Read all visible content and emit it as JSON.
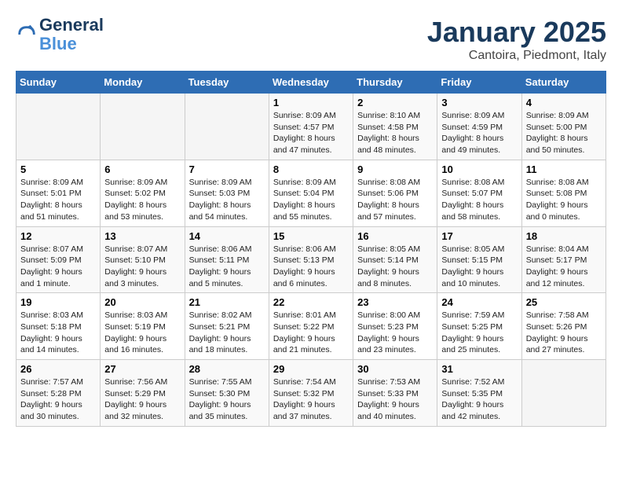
{
  "header": {
    "logo_line1": "General",
    "logo_line2": "Blue",
    "month": "January 2025",
    "location": "Cantoira, Piedmont, Italy"
  },
  "weekdays": [
    "Sunday",
    "Monday",
    "Tuesday",
    "Wednesday",
    "Thursday",
    "Friday",
    "Saturday"
  ],
  "weeks": [
    [
      {
        "day": "",
        "info": ""
      },
      {
        "day": "",
        "info": ""
      },
      {
        "day": "",
        "info": ""
      },
      {
        "day": "1",
        "info": "Sunrise: 8:09 AM\nSunset: 4:57 PM\nDaylight: 8 hours and 47 minutes."
      },
      {
        "day": "2",
        "info": "Sunrise: 8:10 AM\nSunset: 4:58 PM\nDaylight: 8 hours and 48 minutes."
      },
      {
        "day": "3",
        "info": "Sunrise: 8:09 AM\nSunset: 4:59 PM\nDaylight: 8 hours and 49 minutes."
      },
      {
        "day": "4",
        "info": "Sunrise: 8:09 AM\nSunset: 5:00 PM\nDaylight: 8 hours and 50 minutes."
      }
    ],
    [
      {
        "day": "5",
        "info": "Sunrise: 8:09 AM\nSunset: 5:01 PM\nDaylight: 8 hours and 51 minutes."
      },
      {
        "day": "6",
        "info": "Sunrise: 8:09 AM\nSunset: 5:02 PM\nDaylight: 8 hours and 53 minutes."
      },
      {
        "day": "7",
        "info": "Sunrise: 8:09 AM\nSunset: 5:03 PM\nDaylight: 8 hours and 54 minutes."
      },
      {
        "day": "8",
        "info": "Sunrise: 8:09 AM\nSunset: 5:04 PM\nDaylight: 8 hours and 55 minutes."
      },
      {
        "day": "9",
        "info": "Sunrise: 8:08 AM\nSunset: 5:06 PM\nDaylight: 8 hours and 57 minutes."
      },
      {
        "day": "10",
        "info": "Sunrise: 8:08 AM\nSunset: 5:07 PM\nDaylight: 8 hours and 58 minutes."
      },
      {
        "day": "11",
        "info": "Sunrise: 8:08 AM\nSunset: 5:08 PM\nDaylight: 9 hours and 0 minutes."
      }
    ],
    [
      {
        "day": "12",
        "info": "Sunrise: 8:07 AM\nSunset: 5:09 PM\nDaylight: 9 hours and 1 minute."
      },
      {
        "day": "13",
        "info": "Sunrise: 8:07 AM\nSunset: 5:10 PM\nDaylight: 9 hours and 3 minutes."
      },
      {
        "day": "14",
        "info": "Sunrise: 8:06 AM\nSunset: 5:11 PM\nDaylight: 9 hours and 5 minutes."
      },
      {
        "day": "15",
        "info": "Sunrise: 8:06 AM\nSunset: 5:13 PM\nDaylight: 9 hours and 6 minutes."
      },
      {
        "day": "16",
        "info": "Sunrise: 8:05 AM\nSunset: 5:14 PM\nDaylight: 9 hours and 8 minutes."
      },
      {
        "day": "17",
        "info": "Sunrise: 8:05 AM\nSunset: 5:15 PM\nDaylight: 9 hours and 10 minutes."
      },
      {
        "day": "18",
        "info": "Sunrise: 8:04 AM\nSunset: 5:17 PM\nDaylight: 9 hours and 12 minutes."
      }
    ],
    [
      {
        "day": "19",
        "info": "Sunrise: 8:03 AM\nSunset: 5:18 PM\nDaylight: 9 hours and 14 minutes."
      },
      {
        "day": "20",
        "info": "Sunrise: 8:03 AM\nSunset: 5:19 PM\nDaylight: 9 hours and 16 minutes."
      },
      {
        "day": "21",
        "info": "Sunrise: 8:02 AM\nSunset: 5:21 PM\nDaylight: 9 hours and 18 minutes."
      },
      {
        "day": "22",
        "info": "Sunrise: 8:01 AM\nSunset: 5:22 PM\nDaylight: 9 hours and 21 minutes."
      },
      {
        "day": "23",
        "info": "Sunrise: 8:00 AM\nSunset: 5:23 PM\nDaylight: 9 hours and 23 minutes."
      },
      {
        "day": "24",
        "info": "Sunrise: 7:59 AM\nSunset: 5:25 PM\nDaylight: 9 hours and 25 minutes."
      },
      {
        "day": "25",
        "info": "Sunrise: 7:58 AM\nSunset: 5:26 PM\nDaylight: 9 hours and 27 minutes."
      }
    ],
    [
      {
        "day": "26",
        "info": "Sunrise: 7:57 AM\nSunset: 5:28 PM\nDaylight: 9 hours and 30 minutes."
      },
      {
        "day": "27",
        "info": "Sunrise: 7:56 AM\nSunset: 5:29 PM\nDaylight: 9 hours and 32 minutes."
      },
      {
        "day": "28",
        "info": "Sunrise: 7:55 AM\nSunset: 5:30 PM\nDaylight: 9 hours and 35 minutes."
      },
      {
        "day": "29",
        "info": "Sunrise: 7:54 AM\nSunset: 5:32 PM\nDaylight: 9 hours and 37 minutes."
      },
      {
        "day": "30",
        "info": "Sunrise: 7:53 AM\nSunset: 5:33 PM\nDaylight: 9 hours and 40 minutes."
      },
      {
        "day": "31",
        "info": "Sunrise: 7:52 AM\nSunset: 5:35 PM\nDaylight: 9 hours and 42 minutes."
      },
      {
        "day": "",
        "info": ""
      }
    ]
  ]
}
